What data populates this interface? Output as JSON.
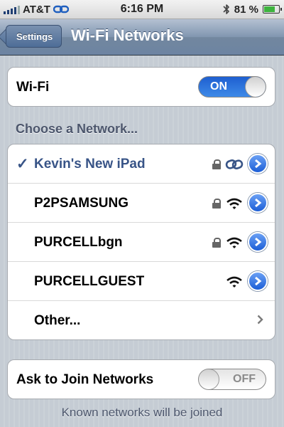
{
  "status_bar": {
    "carrier": "AT&T",
    "time": "6:16 PM",
    "battery_percent": "81 %",
    "battery_level": 0.81
  },
  "nav": {
    "back_label": "Settings",
    "title": "Wi-Fi Networks"
  },
  "wifi_toggle": {
    "label": "Wi-Fi",
    "state": "ON"
  },
  "section_header": "Choose a Network...",
  "networks": [
    {
      "name": "Kevin's New iPad",
      "selected": "✓",
      "icon": "link-icon"
    },
    {
      "name": "P2PSAMSUNG",
      "icon": "wifi-icon"
    },
    {
      "name": "PURCELLbgn",
      "icon": "wifi-icon"
    },
    {
      "name": "PURCELLGUEST",
      "icon": "wifi-icon"
    }
  ],
  "other_label": "Other...",
  "ask_to_join": {
    "label": "Ask to Join Networks",
    "state": "OFF"
  },
  "footer_text": "Known networks will be joined",
  "colors": {
    "accent_blue": "#385487",
    "toggle_on": "#1e5fd0",
    "battery_green": "#3db43d"
  }
}
